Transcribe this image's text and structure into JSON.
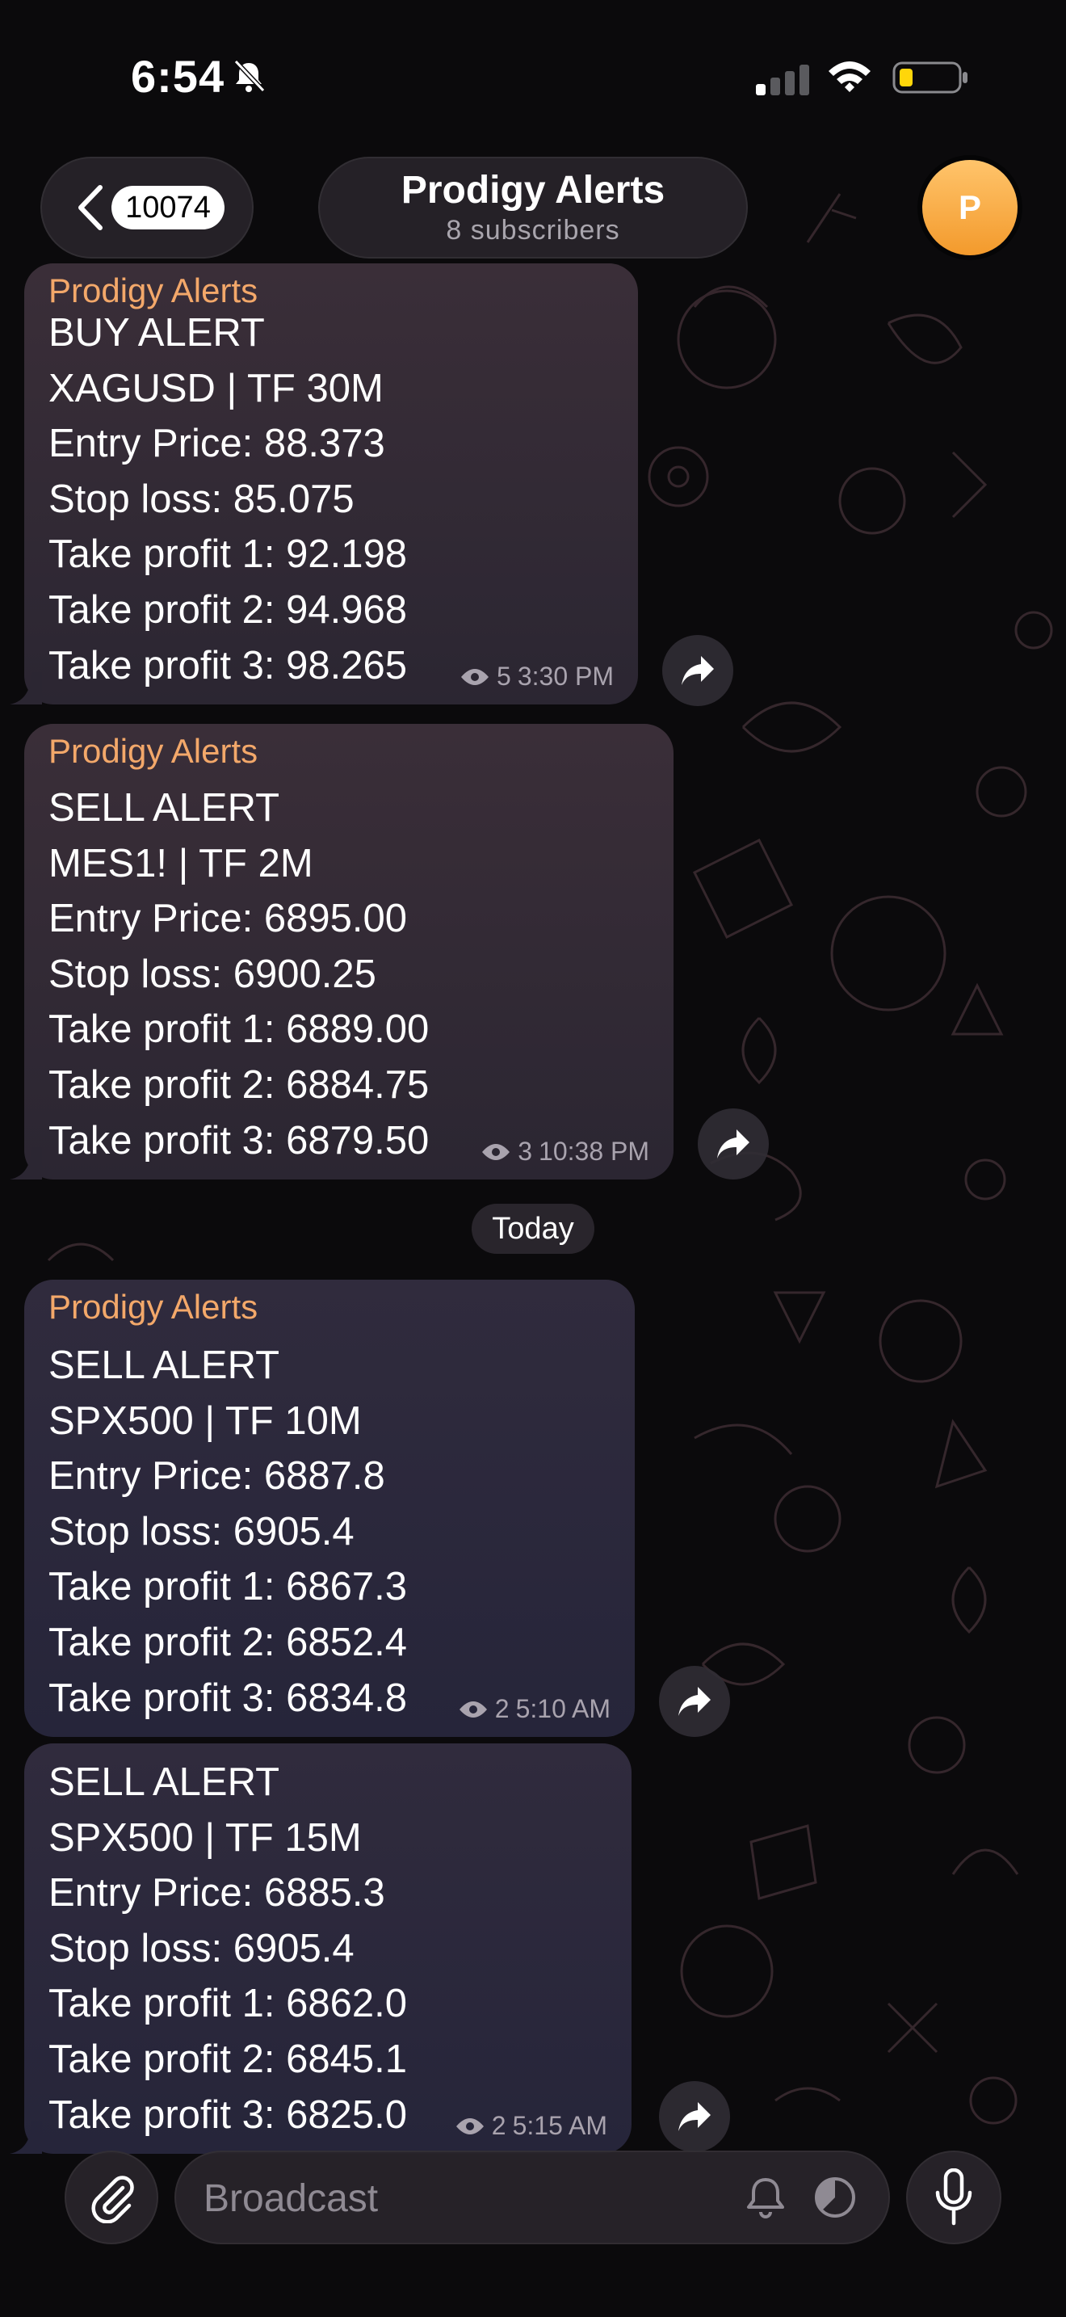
{
  "status_bar": {
    "time": "6:54",
    "icons": [
      "bell-off-icon",
      "cellular-signal-icon",
      "wifi-icon",
      "battery-low-icon"
    ]
  },
  "header": {
    "back_count": "10074",
    "title": "Prodigy Alerts",
    "subtitle": "8 subscribers",
    "avatar_initial": "P"
  },
  "messages": [
    {
      "sender": "Prodigy Alerts",
      "lines": [
        "BUY ALERT",
        "XAGUSD | TF 30M",
        "Entry Price: 88.373",
        "Stop loss: 85.075",
        "Take profit 1: 92.198",
        "Take profit 2: 94.968",
        "Take profit 3: 98.265"
      ],
      "views": "5",
      "time": "3:30 PM"
    },
    {
      "sender": "Prodigy Alerts",
      "lines": [
        "SELL ALERT",
        "MES1! | TF 2M",
        "Entry Price: 6895.00",
        "Stop loss: 6900.25",
        "Take profit 1: 6889.00",
        "Take profit 2: 6884.75",
        "Take profit 3: 6879.50"
      ],
      "views": "3",
      "time": "10:38 PM"
    },
    {
      "sender": "Prodigy Alerts",
      "lines": [
        "SELL ALERT",
        "SPX500 | TF 10M",
        "Entry Price: 6887.8",
        "Stop loss: 6905.4",
        "Take profit 1: 6867.3",
        "Take profit 2: 6852.4",
        "Take profit 3: 6834.8"
      ],
      "views": "2",
      "time": "5:10 AM"
    },
    {
      "lines": [
        "SELL ALERT",
        "SPX500 | TF 15M",
        "Entry Price: 6885.3",
        "Stop loss: 6905.4",
        "Take profit 1: 6862.0",
        "Take profit 2: 6845.1",
        "Take profit 3: 6825.0"
      ],
      "views": "2",
      "time": "5:15 AM"
    }
  ],
  "date_separator": "Today",
  "composer": {
    "placeholder": "Broadcast"
  },
  "colors": {
    "sender_name": "#f3a86a",
    "avatar": "#f5a33a",
    "background": "#0b0a0c"
  }
}
